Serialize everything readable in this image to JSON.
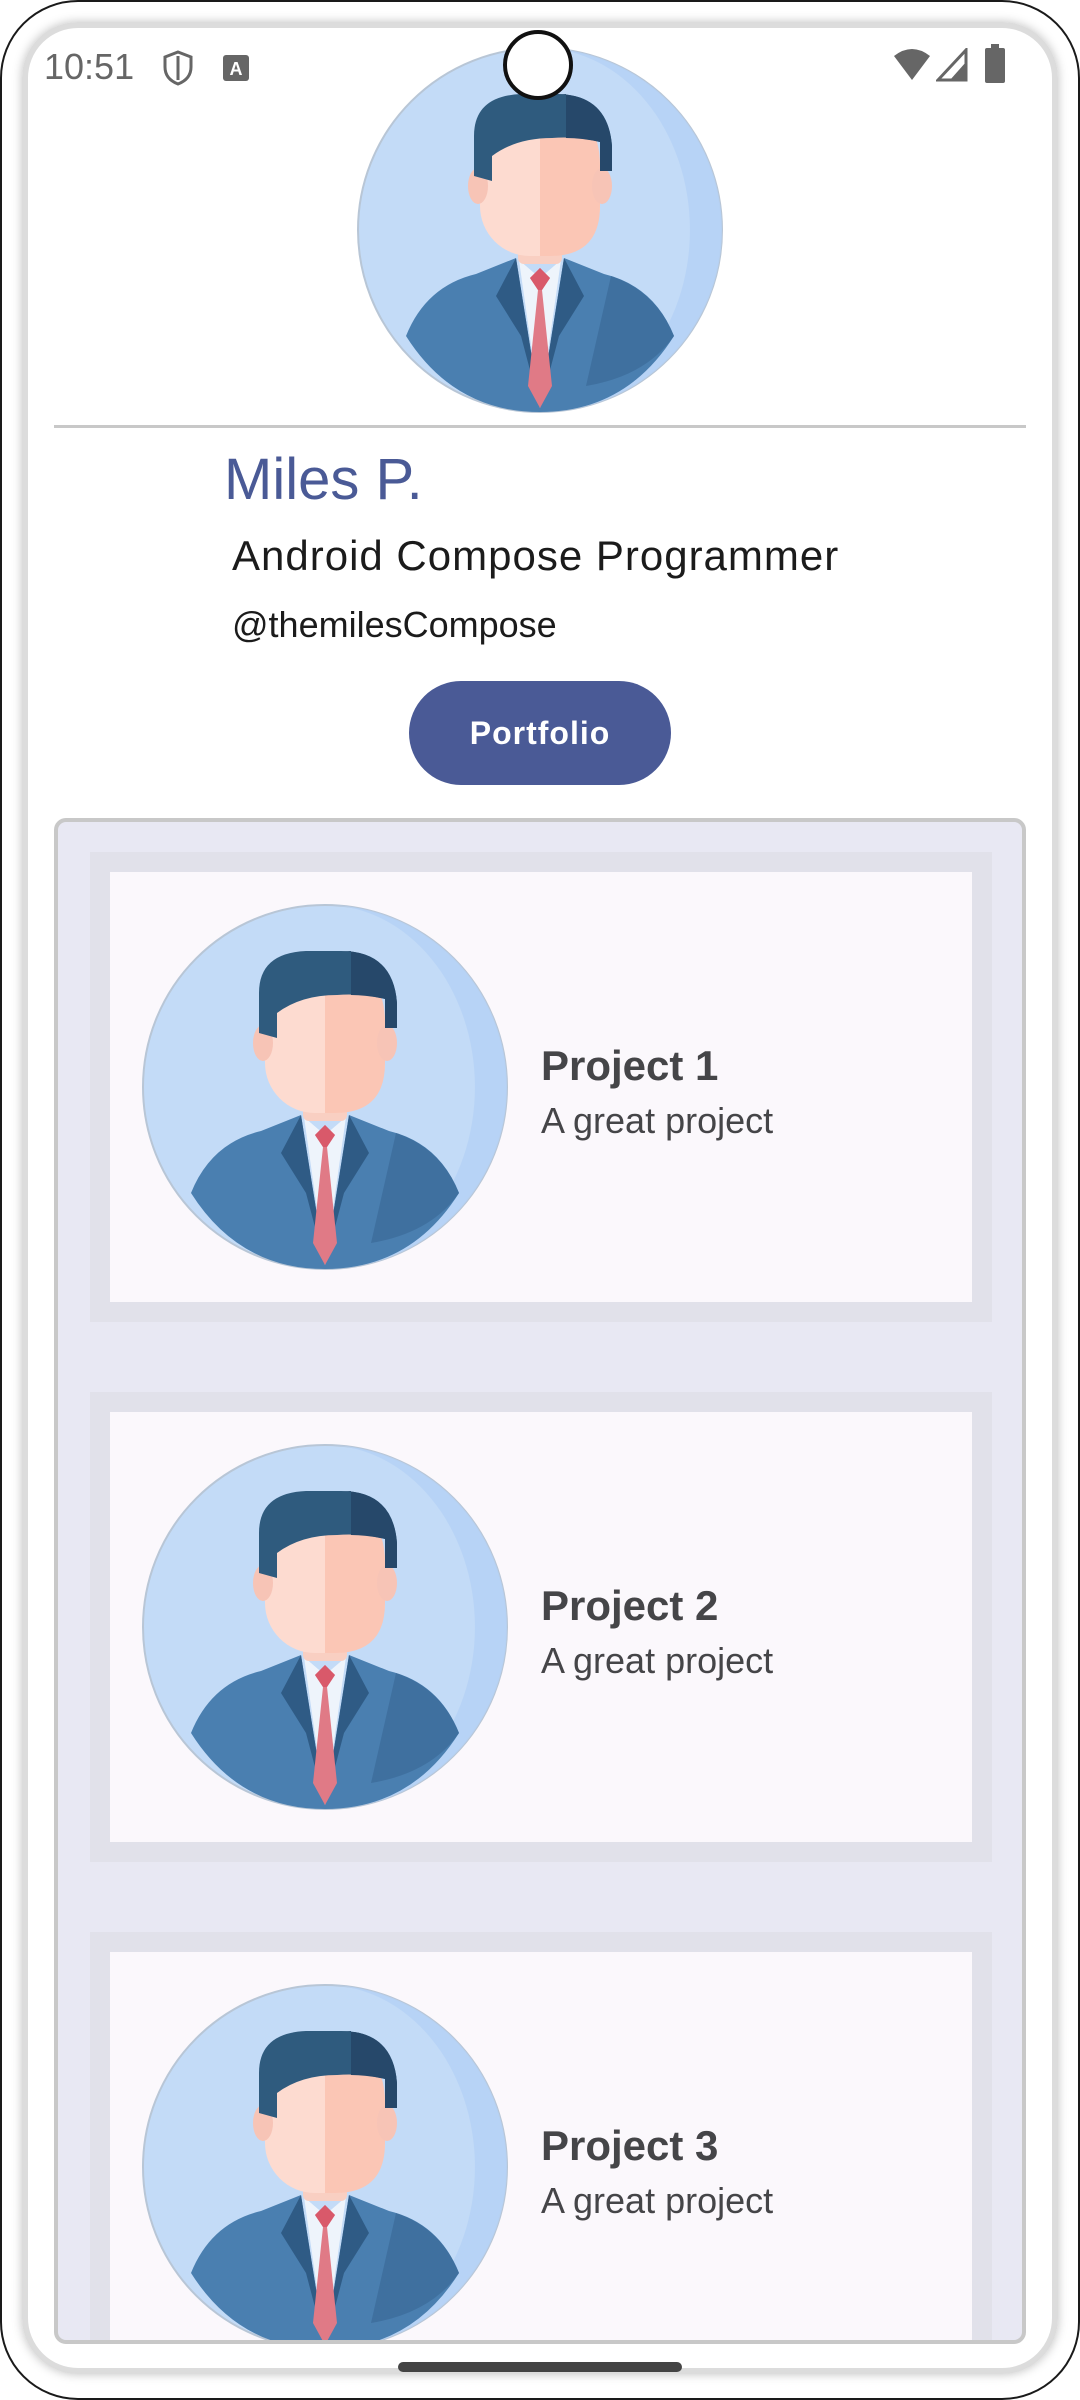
{
  "status_bar": {
    "time": "10:51",
    "icons": [
      "shield-icon",
      "text-a-icon",
      "wifi-icon",
      "signal-icon",
      "battery-icon"
    ]
  },
  "profile": {
    "avatar_icon": "businessman-avatar-icon",
    "name": "Miles P.",
    "title": "Android Compose Programmer",
    "handle": "@themilesCompose",
    "portfolio_label": "Portfolio"
  },
  "projects": [
    {
      "title": "Project 1",
      "description": "A great project",
      "icon": "businessman-avatar-icon"
    },
    {
      "title": "Project 2",
      "description": "A great project",
      "icon": "businessman-avatar-icon"
    },
    {
      "title": "Project 3",
      "description": "A great project",
      "icon": "businessman-avatar-icon"
    }
  ],
  "colors": {
    "accent": "#4a5a96",
    "panel_background": "#e8e8f3",
    "card_border": "#e1e1ea",
    "card_background": "#fbf8fc"
  }
}
